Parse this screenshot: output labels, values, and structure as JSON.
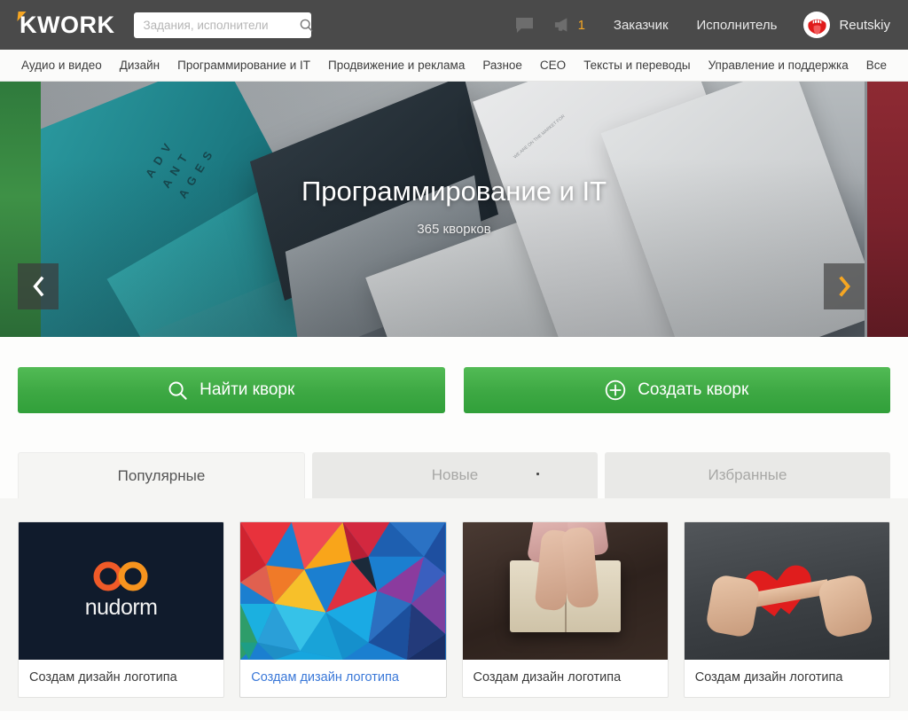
{
  "header": {
    "logo_text": "KWORK",
    "search": {
      "placeholder": "Задания, исполнители",
      "value": "",
      "icon": "search-icon"
    },
    "messages_icon": "chat-bubble-icon",
    "announcements_icon": "megaphone-icon",
    "announcements_count": "1",
    "links": [
      {
        "label": "Заказчик"
      },
      {
        "label": "Исполнитель"
      }
    ],
    "user": {
      "name": "Reutskiy",
      "avatar_icon": "tongue-avatar-icon"
    },
    "colors": {
      "bar": "#4a4a4a",
      "accent": "#f5a623"
    }
  },
  "nav": {
    "items": [
      {
        "label": "Аудио и видео"
      },
      {
        "label": "Дизайн"
      },
      {
        "label": "Программирование и IT"
      },
      {
        "label": "Продвижение и реклама"
      },
      {
        "label": "Разное"
      },
      {
        "label": "CEO"
      },
      {
        "label": "Тексты и переводы"
      },
      {
        "label": "Управление и поддержка"
      },
      {
        "label": "Все"
      }
    ]
  },
  "hero": {
    "title": "Программирование и IT",
    "subtitle": "365 кворков",
    "prev_icon": "chevron-left-icon",
    "next_icon": "chevron-right-icon",
    "prev_label": "",
    "next_label": "",
    "edge_left_color": "#3d8c3a",
    "edge_right_color": "#8c2430",
    "paper_text": "WE ARE ON THE MARKET FOR"
  },
  "actions": {
    "find": {
      "label": "Найти кворк",
      "icon": "search-icon"
    },
    "create": {
      "label": "Создать кворк",
      "icon": "plus-circle-icon"
    },
    "color": "#3da843"
  },
  "tabs": [
    {
      "label": "Популярные",
      "active": true
    },
    {
      "label": "Новые",
      "active": false
    },
    {
      "label": "Избранные",
      "active": false
    }
  ],
  "cards": [
    {
      "title": "Создам дизайн логотипа",
      "thumb": "nudorm-logo-thumb",
      "logo_word": "nudorm",
      "hovered": false
    },
    {
      "title": "Создам дизайн логотипа",
      "thumb": "polygon-art-thumb",
      "logo_word": "",
      "hovered": true
    },
    {
      "title": "Создам дизайн логотипа",
      "thumb": "hands-on-book-thumb",
      "logo_word": "",
      "hovered": false
    },
    {
      "title": "Создам дизайн логотипа",
      "thumb": "hands-holding-heart-thumb",
      "logo_word": "",
      "hovered": false
    }
  ]
}
